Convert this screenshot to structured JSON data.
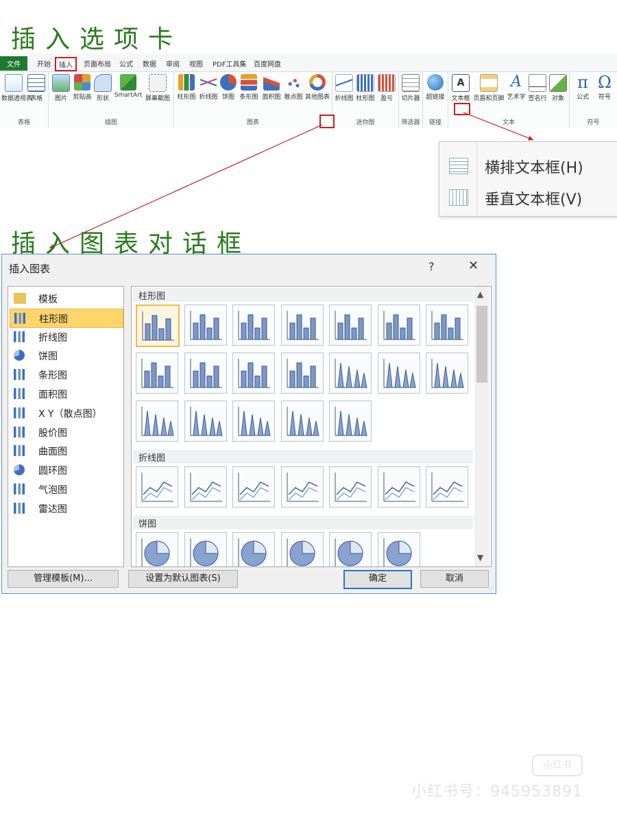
{
  "headings": {
    "insert_tab": "插入选项卡",
    "insert_chart_dialog": "插入图表对话框"
  },
  "ribbon": {
    "tabs": [
      "文件",
      "开始",
      "插入",
      "页面布局",
      "公式",
      "数据",
      "审阅",
      "视图",
      "PDF工具集",
      "百度网盘"
    ],
    "groups": [
      {
        "label": "表格",
        "buttons": [
          {
            "label": "数据透视表",
            "icon": "pivot-table-icon"
          },
          {
            "label": "表格",
            "icon": "table-icon"
          }
        ]
      },
      {
        "label": "插图",
        "buttons": [
          {
            "label": "图片",
            "icon": "picture-icon"
          },
          {
            "label": "剪贴画",
            "icon": "clipart-icon"
          },
          {
            "label": "形状",
            "icon": "shapes-icon"
          },
          {
            "label": "SmartArt",
            "icon": "smartart-icon"
          },
          {
            "label": "屏幕截图",
            "icon": "screenshot-icon"
          }
        ]
      },
      {
        "label": "图表",
        "buttons": [
          {
            "label": "柱形图",
            "icon": "column-chart-icon"
          },
          {
            "label": "折线图",
            "icon": "line-chart-icon"
          },
          {
            "label": "饼图",
            "icon": "pie-chart-icon"
          },
          {
            "label": "条形图",
            "icon": "bar-chart-icon"
          },
          {
            "label": "面积图",
            "icon": "area-chart-icon"
          },
          {
            "label": "散点图",
            "icon": "scatter-chart-icon"
          },
          {
            "label": "其他图表",
            "icon": "other-charts-icon"
          }
        ]
      },
      {
        "label": "迷你图",
        "buttons": [
          {
            "label": "折线图",
            "icon": "sparkline-line-icon"
          },
          {
            "label": "柱形图",
            "icon": "sparkline-column-icon"
          },
          {
            "label": "盈亏",
            "icon": "win-loss-icon"
          }
        ]
      },
      {
        "label": "筛选器",
        "buttons": [
          {
            "label": "切片器",
            "icon": "slicer-icon"
          }
        ]
      },
      {
        "label": "链接",
        "buttons": [
          {
            "label": "超链接",
            "icon": "hyperlink-icon"
          }
        ]
      },
      {
        "label": "文本",
        "buttons": [
          {
            "label": "文本框",
            "icon": "textbox-icon"
          },
          {
            "label": "页眉和页脚",
            "icon": "header-footer-icon"
          },
          {
            "label": "艺术字",
            "icon": "wordart-icon"
          },
          {
            "label": "签名行",
            "icon": "signature-line-icon"
          },
          {
            "label": "对象",
            "icon": "object-icon"
          }
        ]
      },
      {
        "label": "符号",
        "buttons": [
          {
            "label": "公式",
            "icon": "equation-icon"
          },
          {
            "label": "符号",
            "icon": "symbol-icon"
          }
        ]
      }
    ]
  },
  "textbox_menu": [
    {
      "label": "横排文本框(H)",
      "icon": "horizontal-textbox-icon"
    },
    {
      "label": "垂直文本框(V)",
      "icon": "vertical-textbox-icon"
    }
  ],
  "dialog": {
    "title": "插入图表",
    "help": "?",
    "close": "✕",
    "categories": [
      {
        "label": "模板",
        "icon": "folder-icon"
      },
      {
        "label": "柱形图",
        "icon": "column-chart-icon"
      },
      {
        "label": "折线图",
        "icon": "line-chart-icon"
      },
      {
        "label": "饼图",
        "icon": "pie-chart-icon"
      },
      {
        "label": "条形图",
        "icon": "bar-chart-icon"
      },
      {
        "label": "面积图",
        "icon": "area-chart-icon"
      },
      {
        "label": "X Y（散点图）",
        "icon": "scatter-chart-icon"
      },
      {
        "label": "股价图",
        "icon": "stock-chart-icon"
      },
      {
        "label": "曲面图",
        "icon": "surface-chart-icon"
      },
      {
        "label": "圆环图",
        "icon": "doughnut-chart-icon"
      },
      {
        "label": "气泡图",
        "icon": "bubble-chart-icon"
      },
      {
        "label": "雷达图",
        "icon": "radar-chart-icon"
      }
    ],
    "selected_category": 1,
    "sections": [
      {
        "label": "柱形图",
        "thumbnails": [
          "clustered-column-icon",
          "stacked-column-icon",
          "100-stacked-column-icon",
          "3d-clustered-column-icon",
          "3d-stacked-column-icon",
          "3d-100-stacked-column-icon",
          "3d-column-icon",
          "clustered-cylinder-icon",
          "stacked-cylinder-icon",
          "100-stacked-cylinder-icon",
          "3d-cylinder-icon",
          "clustered-cone-icon",
          "stacked-cone-icon",
          "100-stacked-cone-icon",
          "3d-cone-icon",
          "clustered-pyramid-icon",
          "stacked-pyramid-icon",
          "100-stacked-pyramid-icon",
          "3d-pyramid-icon"
        ]
      },
      {
        "label": "折线图",
        "thumbnails": [
          "line-icon",
          "stacked-line-icon",
          "100-stacked-line-icon",
          "line-markers-icon",
          "stacked-line-markers-icon",
          "100-stacked-line-markers-icon",
          "3d-line-icon"
        ]
      },
      {
        "label": "饼图",
        "thumbnails": [
          "pie-icon",
          "3d-pie-icon",
          "pie-of-pie-icon",
          "exploded-pie-icon",
          "3d-exploded-pie-icon",
          "bar-of-pie-icon"
        ]
      }
    ],
    "buttons": {
      "manage_templates": "管理模板(M)...",
      "set_default": "设置为默认图表(S)",
      "ok": "确定",
      "cancel": "取消"
    }
  },
  "watermark": {
    "logo": "小红书",
    "text": "小红书号：945953891"
  },
  "colors": {
    "heading": "#2a7a1e",
    "highlight": "#d21c1c",
    "accent": "#2f74c0",
    "selection": "#fdd56a"
  }
}
